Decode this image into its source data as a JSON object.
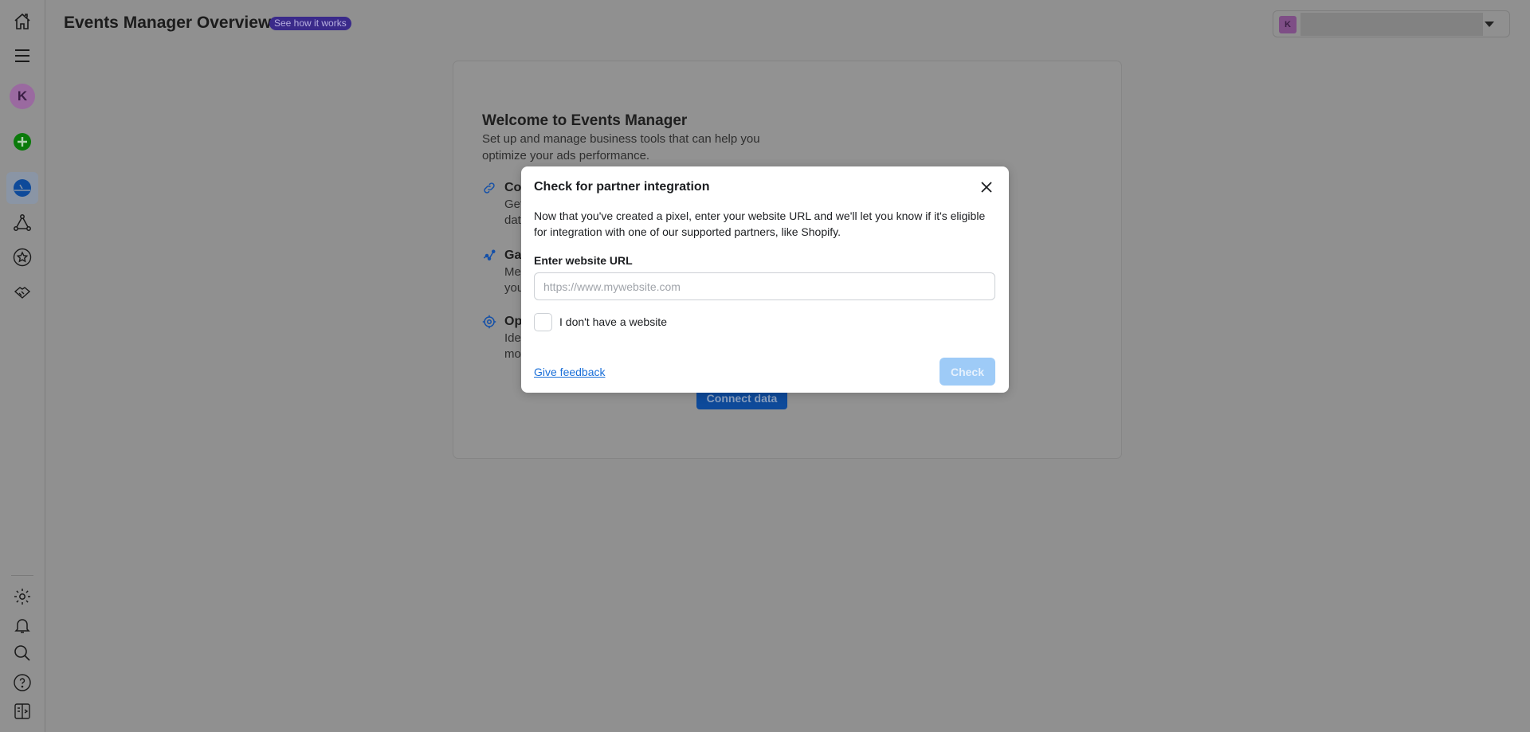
{
  "header": {
    "title": "Events Manager Overview",
    "badge": "See how it works",
    "account_initial": "K"
  },
  "sidebar": {
    "avatar_initial": "K",
    "items": [
      "home-icon",
      "menu-icon",
      "avatar",
      "create-icon",
      "overview-icon",
      "partner-integrations-icon",
      "favorites-icon",
      "partners-icon"
    ],
    "bottom_items": [
      "settings-icon",
      "notifications-icon",
      "search-icon",
      "help-icon",
      "sidebar-toggle-icon"
    ]
  },
  "card": {
    "title": "Welcome to Events Manager",
    "description": "Set up and manage business tools that can help you optimize your ads performance.",
    "items": [
      {
        "heading": "Co",
        "lines": [
          "Get",
          "data"
        ],
        "icon": "link-icon"
      },
      {
        "heading": "Gai",
        "lines": [
          "Mea",
          "you"
        ],
        "icon": "insights-icon"
      },
      {
        "heading": "Opt",
        "lines": [
          "Iden",
          "mos"
        ],
        "icon": "target-icon"
      }
    ],
    "connect_label": "Connect data"
  },
  "modal": {
    "title": "Check for partner integration",
    "description": "Now that you've created a pixel, enter your website URL and we'll let you know if it's eligible for integration with one of our supported partners, like Shopify.",
    "url_label": "Enter website URL",
    "url_placeholder": "https://www.mywebsite.com",
    "url_value": "",
    "no_website_label": "I don't have a website",
    "no_website_checked": false,
    "feedback_label": "Give feedback",
    "check_label": "Check"
  },
  "colors": {
    "accent": "#1877f2",
    "badge": "#3a2a8a",
    "create": "#0a7a0a",
    "check_disabled": "#9ecbf7"
  }
}
